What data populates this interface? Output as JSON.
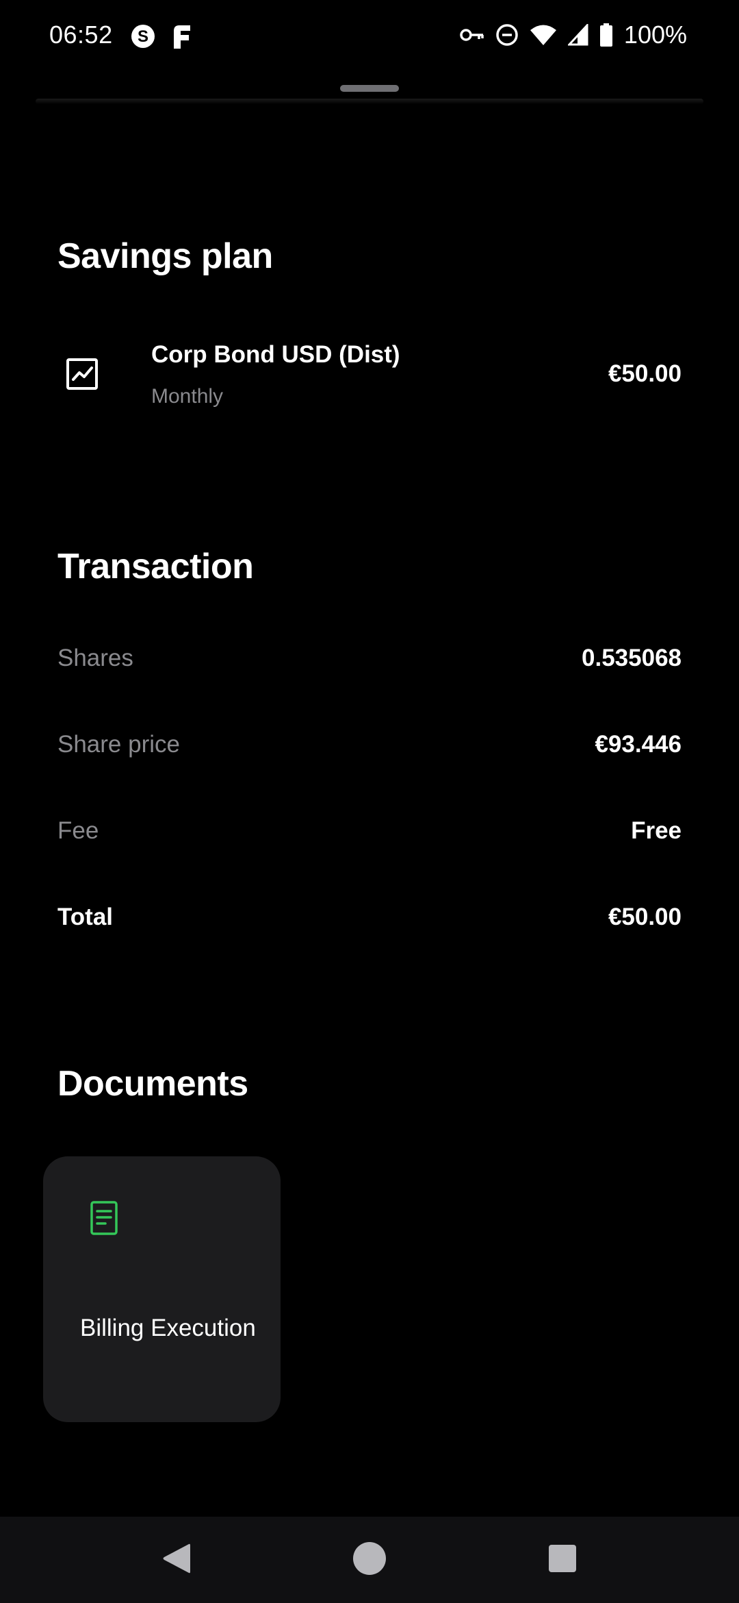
{
  "status_bar": {
    "time": "06:52",
    "battery": "100%",
    "left_icons": [
      "s-circle-icon",
      "app-logo-icon"
    ],
    "right_icons": [
      "key-icon",
      "dnd-icon",
      "wifi-icon",
      "signal-icon",
      "battery-icon"
    ]
  },
  "savings_plan": {
    "title": "Savings plan",
    "item": {
      "icon": "chart-icon",
      "name": "Corp Bond USD (Dist)",
      "frequency": "Monthly",
      "amount": "€50.00"
    }
  },
  "transaction": {
    "title": "Transaction",
    "rows": [
      {
        "label": "Shares",
        "value": "0.535068"
      },
      {
        "label": "Share price",
        "value": "€93.446"
      },
      {
        "label": "Fee",
        "value": "Free"
      },
      {
        "label": "Total",
        "value": "€50.00"
      }
    ]
  },
  "documents": {
    "title": "Documents",
    "items": [
      {
        "label": "Billing Execution",
        "icon": "document-icon",
        "icon_color": "#34c759"
      }
    ]
  },
  "nav_bar": {
    "buttons": [
      "back-icon",
      "home-icon",
      "recents-icon"
    ]
  }
}
